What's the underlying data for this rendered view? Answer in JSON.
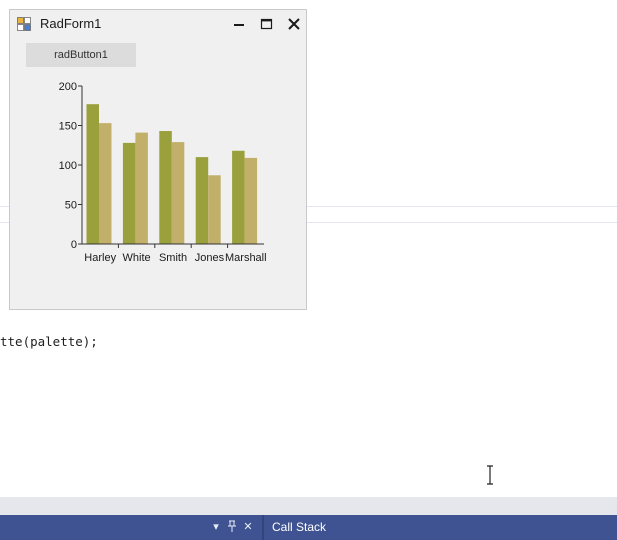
{
  "form": {
    "title": "RadForm1",
    "button_label": "radButton1"
  },
  "code": {
    "visible_text": "tte(palette);"
  },
  "ide": {
    "panel_tab": "Call Stack",
    "controls": [
      "▾",
      "⊥",
      "✕"
    ]
  },
  "colors": {
    "series_1": "#9aa03c",
    "series_2": "#c2b06a",
    "ide_bar": "#3f5392"
  },
  "icons": [
    "form-icon",
    "minimize-icon",
    "maximize-icon",
    "close-icon",
    "dropdown-icon",
    "pin-icon",
    "panel-close-icon",
    "text-cursor-icon"
  ],
  "chart_data": {
    "type": "bar",
    "categories": [
      "Harley",
      "White",
      "Smith",
      "Jones",
      "Marshall"
    ],
    "series": [
      {
        "values": [
          177,
          128,
          143,
          110,
          118
        ]
      },
      {
        "values": [
          153,
          141,
          129,
          87,
          109
        ]
      }
    ],
    "yticks": [
      0,
      50,
      100,
      150,
      200
    ],
    "ylim": [
      0,
      200
    ],
    "title": "",
    "xlabel": "",
    "ylabel": "",
    "grid": false,
    "legend": "none"
  }
}
